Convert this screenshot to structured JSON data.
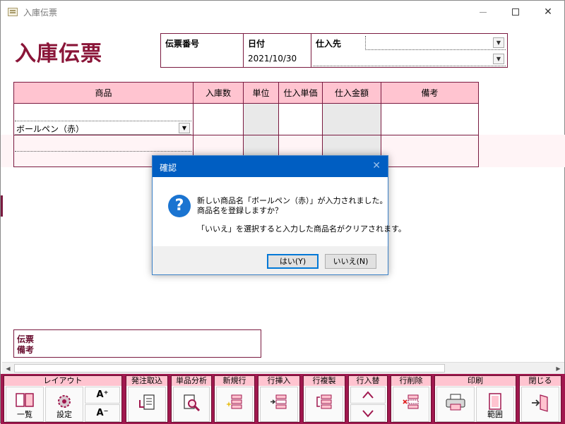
{
  "window": {
    "title": "入庫伝票"
  },
  "page": {
    "title": "入庫伝票"
  },
  "header": {
    "slip_no_label": "伝票番号",
    "slip_no_value": "",
    "date_label": "日付",
    "date_value": "2021/10/30",
    "supplier_label": "仕入先"
  },
  "grid": {
    "columns": [
      "商品",
      "入庫数",
      "単位",
      "仕入単価",
      "仕入金額",
      "備考"
    ],
    "rows": [
      {
        "product": "ボールペン（赤）"
      }
    ]
  },
  "memo": {
    "label_line1": "伝票",
    "label_line2": "備考"
  },
  "toolbar": {
    "layout_label": "レイアウト",
    "list_label": "一覧",
    "settings_label": "設定",
    "font_up_label": "A⁺",
    "font_down_label": "A⁻",
    "order_import_label": "発注取込",
    "product_analysis_label": "単品分析",
    "new_row_label": "新規行",
    "insert_row_label": "行挿入",
    "copy_row_label": "行複製",
    "swap_row_label": "行入替",
    "delete_row_label": "行削除",
    "print_label": "印刷",
    "range_label": "範囲",
    "close_label": "閉じる"
  },
  "dialog": {
    "title": "確認",
    "line1": "新しい商品名「ボールペン（赤）」が入力されました。",
    "line2": "商品名を登録しますか？",
    "line3": "「いいえ」を選択すると入力した商品名がクリアされます。",
    "yes_label": "はい(Y)",
    "no_label": "いいえ(N)"
  },
  "colors": {
    "accent": "#a0184e",
    "header_pink": "#ffc4d0",
    "dialog_title": "#005ec2"
  }
}
